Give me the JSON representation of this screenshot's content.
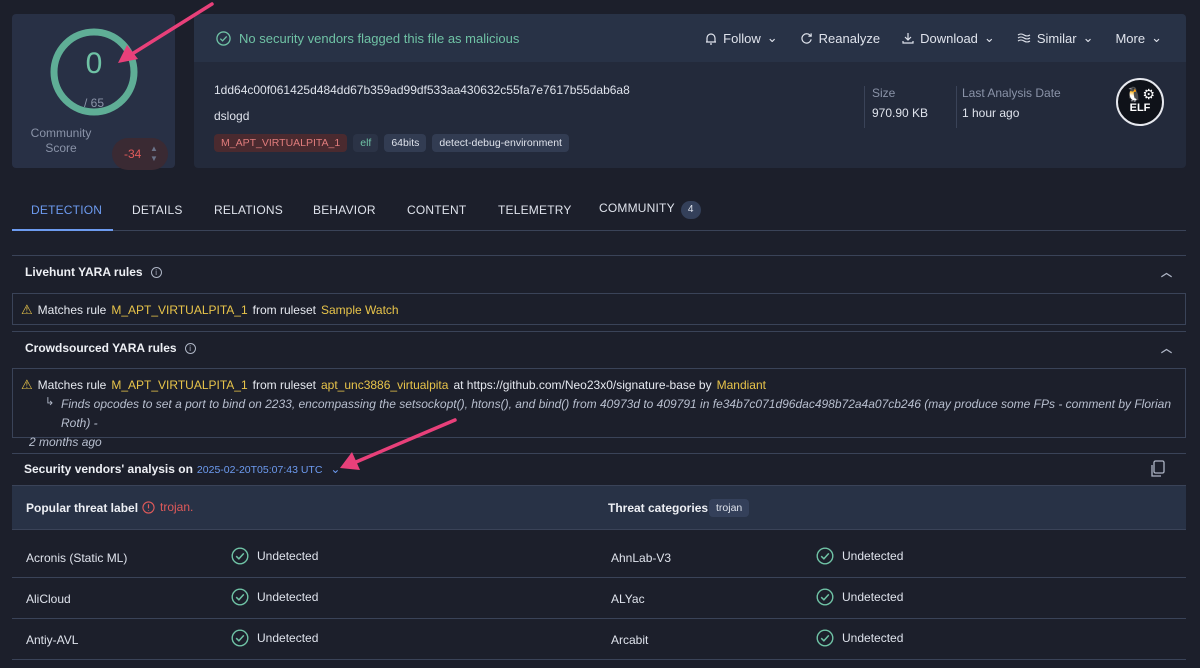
{
  "score": {
    "detections": "0",
    "total": "/ 65",
    "community_label": "Community\nScore",
    "community_value": "-34"
  },
  "header": {
    "status_message": "No security vendors flagged this file as malicious",
    "toolbar": {
      "follow": "Follow",
      "reanalyze": "Reanalyze",
      "download": "Download",
      "similar": "Similar",
      "more": "More"
    },
    "hash": "1dd64c00f061425d484dd67b359ad99df533aa430632c55fa7e7617b55dab6a8",
    "file_name": "dslogd",
    "tags": [
      "M_APT_VIRTUALPITA_1",
      "elf",
      "64bits",
      "detect-debug-environment"
    ],
    "size_label": "Size",
    "size_value": "970.90 KB",
    "date_label": "Last Analysis Date",
    "date_value": "1 hour ago",
    "file_type_badge": "ELF"
  },
  "tabs": [
    {
      "label": "DETECTION"
    },
    {
      "label": "DETAILS"
    },
    {
      "label": "RELATIONS"
    },
    {
      "label": "BEHAVIOR"
    },
    {
      "label": "CONTENT"
    },
    {
      "label": "TELEMETRY"
    },
    {
      "label": "COMMUNITY",
      "badge": "4"
    }
  ],
  "livehunt": {
    "title": "Livehunt YARA rules",
    "prefix": "Matches rule",
    "rule": "M_APT_VIRTUALPITA_1",
    "mid": "from ruleset",
    "ruleset": "Sample Watch"
  },
  "crowdsourced": {
    "title": "Crowdsourced YARA rules",
    "prefix": "Matches rule",
    "rule": "M_APT_VIRTUALPITA_1",
    "mid": "from ruleset",
    "ruleset": "apt_unc3886_virtualpita",
    "at": "at https://github.com/Neo23x0/signature-base by",
    "author": "Mandiant",
    "note_line1": "Finds opcodes to set a port to bind on 2233, encompassing the setsockopt(), htons(), and bind() from 40973d to 409791 in fe34b7c071d96dac498b72a4a07cb246 (may produce some FPs - comment by Florian Roth) -",
    "note_line2": "2 months ago"
  },
  "vendors": {
    "title": "Security vendors' analysis on",
    "date": "2025-02-20T05:07:43 UTC",
    "popular_label": "Popular threat label",
    "popular_value": "trojan.",
    "categories_label": "Threat categories",
    "categories_value": "trojan",
    "rows": [
      {
        "left_name": "Acronis (Static ML)",
        "left_result": "Undetected",
        "right_name": "AhnLab-V3",
        "right_result": "Undetected"
      },
      {
        "left_name": "AliCloud",
        "left_result": "Undetected",
        "right_name": "ALYac",
        "right_result": "Undetected"
      },
      {
        "left_name": "Antiy-AVL",
        "left_result": "Undetected",
        "right_name": "Arcabit",
        "right_result": "Undetected"
      }
    ]
  },
  "colors": {
    "background": "#1c1f2b",
    "accent_blue": "#6d9bf0",
    "clean_green": "#6fc2a5",
    "malicious_red": "#e05a5a",
    "rule_yellow": "#e8c44a",
    "annotation_pink": "#e8407a"
  }
}
